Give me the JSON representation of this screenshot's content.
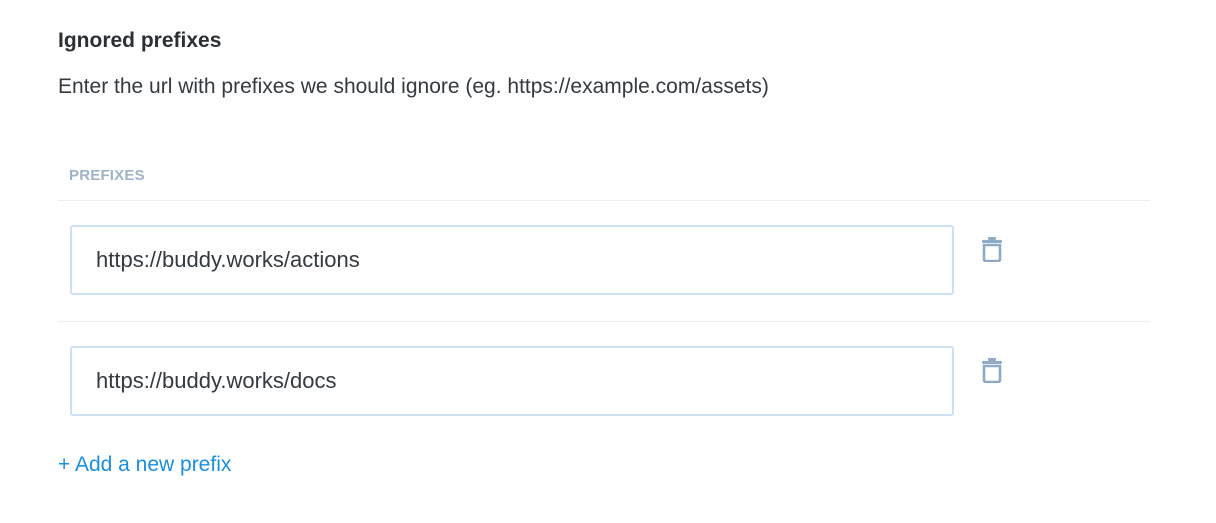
{
  "section": {
    "title": "Ignored prefixes",
    "description": "Enter the url with prefixes we should ignore (eg. https://example.com/assets)"
  },
  "table": {
    "column_header": "PREFIXES",
    "rows": [
      {
        "value": "https://buddy.works/actions",
        "delete_icon": "trash-icon"
      },
      {
        "value": "https://buddy.works/docs",
        "delete_icon": "trash-icon"
      }
    ]
  },
  "add_link_label": "+ Add a new prefix",
  "colors": {
    "accent": "#1a8fe0",
    "icon": "#8fa9c7",
    "input_border": "#cfe0f1",
    "header_text": "#9fb3c8"
  }
}
